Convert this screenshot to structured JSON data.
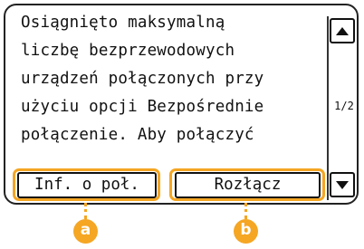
{
  "message": {
    "lines": [
      "Osiągnięto maksymalną",
      "liczbę bezprzewodowych",
      "urządzeń połączonych przy",
      "użyciu opcji Bezpośrednie",
      "połączenie. Aby połączyć"
    ]
  },
  "scroll": {
    "page_indicator": "1/2",
    "up_icon": "triangle-up",
    "down_icon": "triangle-down"
  },
  "buttons": {
    "info_label": "Inf. o poł.",
    "disconnect_label": "Rozłącz"
  },
  "callouts": {
    "a": "a",
    "b": "b",
    "color": "#f5a623"
  }
}
